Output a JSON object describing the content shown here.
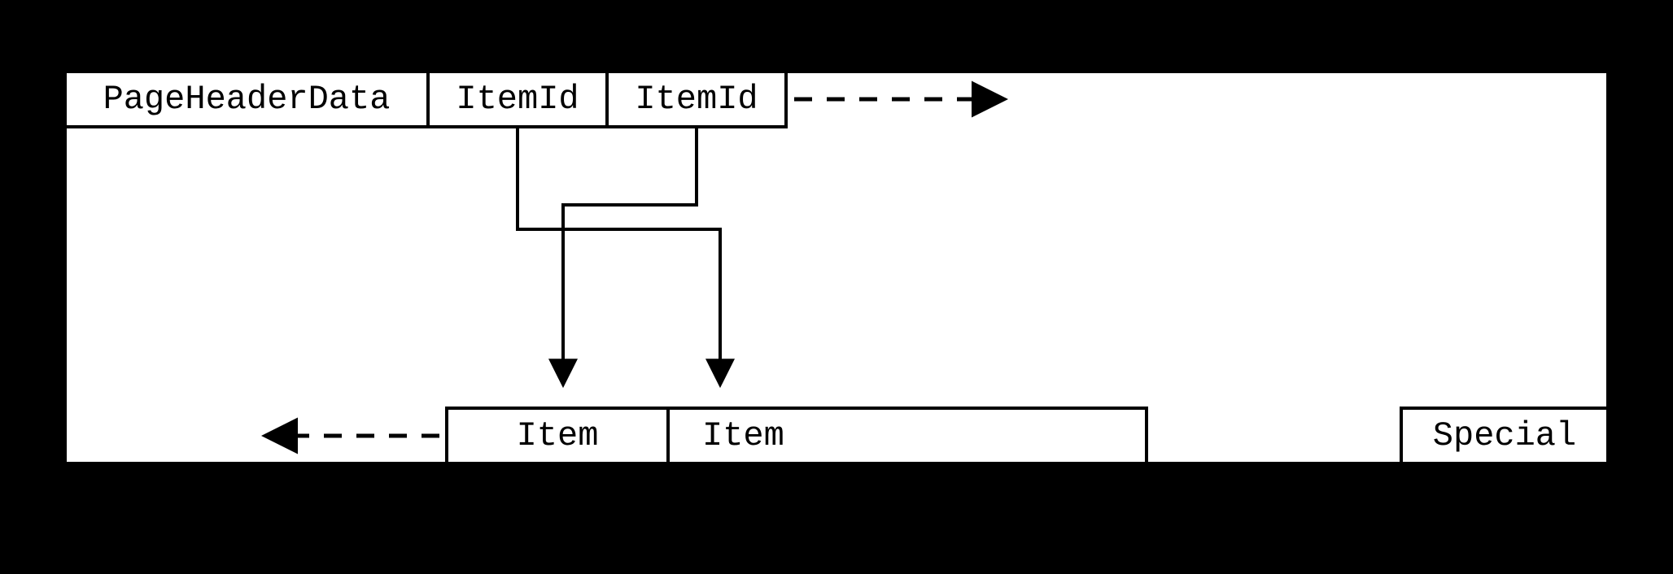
{
  "diagram": {
    "header": {
      "page_header_data": "PageHeaderData",
      "item_id_1": "ItemId",
      "item_id_2": "ItemId"
    },
    "footer": {
      "item_1": "Item",
      "item_2": "Item",
      "special": "Special"
    }
  }
}
